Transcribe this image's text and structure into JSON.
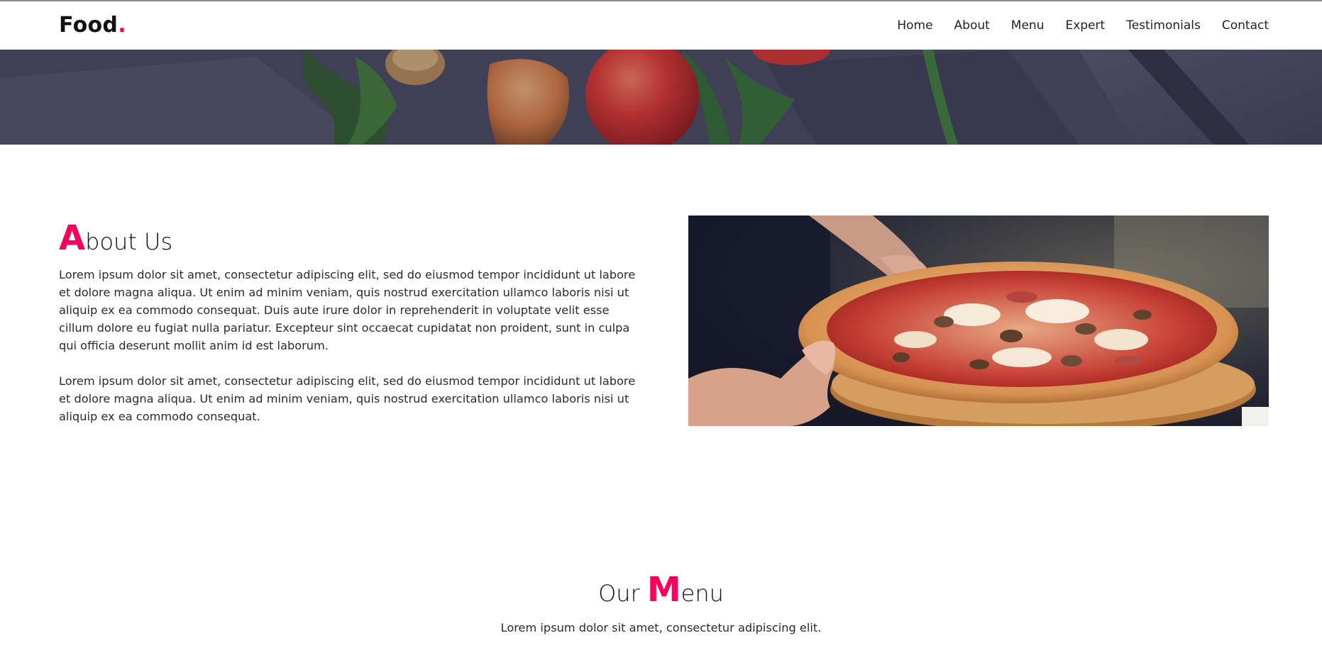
{
  "brand": {
    "name": "Food",
    "dot": "."
  },
  "nav": {
    "items": [
      {
        "label": "Home"
      },
      {
        "label": "About"
      },
      {
        "label": "Menu"
      },
      {
        "label": "Expert"
      },
      {
        "label": "Testimonials"
      },
      {
        "label": "Contact"
      }
    ]
  },
  "about": {
    "title_first": "A",
    "title_rest": "bout Us",
    "paragraph1": "Lorem ipsum dolor sit amet, consectetur adipiscing elit, sed do eiusmod tempor incididunt ut labore et dolore magna aliqua. Ut enim ad minim veniam, quis nostrud exercitation ullamco laboris nisi ut aliquip ex ea commodo consequat. Duis aute irure dolor in reprehenderit in voluptate velit esse cillum dolore eu fugiat nulla pariatur. Excepteur sint occaecat cupidatat non proident, sunt in culpa qui officia deserunt mollit anim id est laborum.",
    "paragraph2": "Lorem ipsum dolor sit amet, consectetur adipiscing elit, sed do eiusmod tempor incididunt ut labore et dolore magna aliqua. Ut enim ad minim veniam, quis nostrud exercitation ullamco laboris nisi ut aliquip ex ea commodo consequat."
  },
  "menu": {
    "title_prefix": "Our ",
    "title_first": "M",
    "title_rest": "enu",
    "subtitle": "Lorem ipsum dolor sit amet, consectetur adipiscing elit."
  },
  "colors": {
    "accent": "#f7005f",
    "text": "#222222",
    "hero_overlay": "#3a3a52"
  },
  "icons": {
    "hero": "vegetables-photo",
    "about": "pizza-photo"
  }
}
